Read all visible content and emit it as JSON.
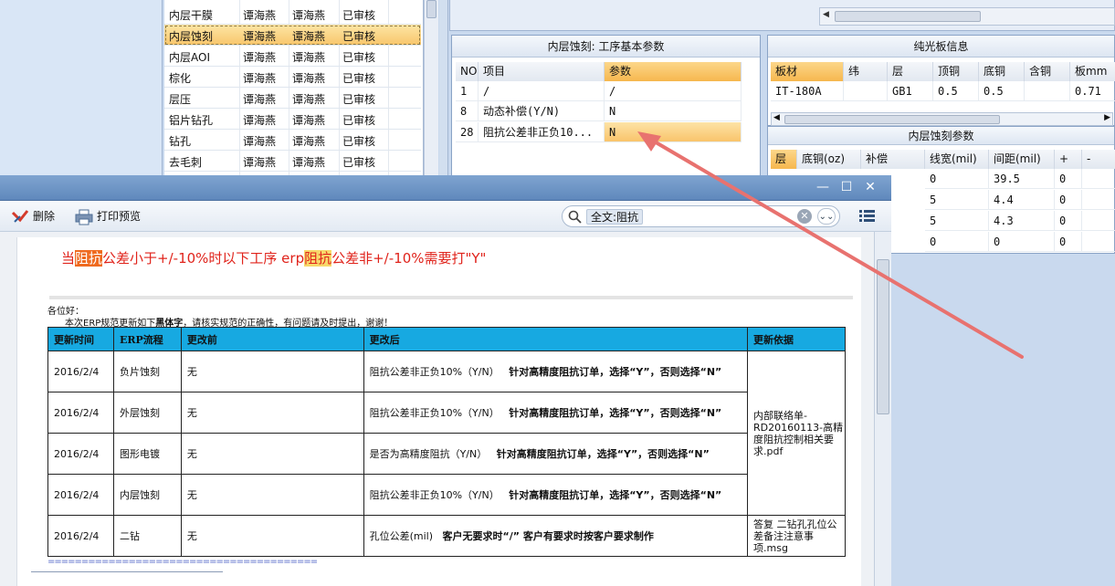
{
  "process_list": {
    "rows": [
      {
        "name": "内层干膜",
        "a": "谭海燕",
        "b": "谭海燕",
        "status": "已审核"
      },
      {
        "name": "内层蚀刻",
        "a": "谭海燕",
        "b": "谭海燕",
        "status": "已审核"
      },
      {
        "name": "内层AOI",
        "a": "谭海燕",
        "b": "谭海燕",
        "status": "已审核"
      },
      {
        "name": "棕化",
        "a": "谭海燕",
        "b": "谭海燕",
        "status": "已审核"
      },
      {
        "name": "层压",
        "a": "谭海燕",
        "b": "谭海燕",
        "status": "已审核"
      },
      {
        "name": "铝片钻孔",
        "a": "谭海燕",
        "b": "谭海燕",
        "status": "已审核"
      },
      {
        "name": "钻孔",
        "a": "谭海燕",
        "b": "谭海燕",
        "status": "已审核"
      },
      {
        "name": "去毛刺",
        "a": "谭海燕",
        "b": "谭海燕",
        "status": "已审核"
      }
    ]
  },
  "params_panel": {
    "title": "内层蚀刻: 工序基本参数",
    "headers": {
      "no": "NO",
      "item": "项目",
      "param": "参数"
    },
    "rows": [
      {
        "no": "1",
        "item": "/",
        "param": "/"
      },
      {
        "no": "8",
        "item": "动态补偿(Y/N)",
        "param": "N"
      },
      {
        "no": "28",
        "item": "阻抗公差非正负10...",
        "param": "N"
      }
    ]
  },
  "light_board": {
    "title": "纯光板信息",
    "headers": [
      "板材",
      "纬",
      "层",
      "顶铜",
      "底铜",
      "含铜",
      "板mm"
    ],
    "row": [
      "IT-180A",
      "",
      "GB1",
      "0.5",
      "0.5",
      "",
      "0.71"
    ]
  },
  "etch_params": {
    "title": "内层蚀刻参数",
    "headers": [
      "层",
      "底铜(oz)",
      "补偿",
      "线宽(mil)",
      "间距(mil)",
      "+",
      "-"
    ],
    "rows": [
      [
        "",
        "",
        "",
        "0",
        "39.5",
        "0",
        ""
      ],
      [
        "",
        "",
        "",
        "5",
        "4.4",
        "0",
        ""
      ],
      [
        "",
        "",
        "",
        "5",
        "4.3",
        "0",
        ""
      ],
      [
        "",
        "",
        "",
        "0",
        "0",
        "0",
        ""
      ]
    ]
  },
  "window": {
    "toolbar": {
      "delete_label": "删除",
      "print_preview_label": "打印预览"
    },
    "search": {
      "tag": "全文:阻抗"
    }
  },
  "document": {
    "headline": {
      "p1": "当",
      "p2": "阻抗",
      "p3": "公差小于+/-10%时以下工序 erp",
      "p4": "阻抗",
      "p5": "公差非+/-10%需要打\"Y\""
    },
    "greeting": "各位好：",
    "intro": {
      "before": "本次ERP规范更新如下",
      "bold": "黑体字",
      "after": "，请核实规范的正确性，有问题请及时提出，谢谢！"
    },
    "table": {
      "headers": [
        "更新时间",
        "ERP流程",
        "更改前",
        "更改后",
        "更新依据"
      ],
      "rows": [
        {
          "date": "2016/2/4",
          "flow": "负片蚀刻",
          "before": "无",
          "after_plain": "阻抗公差非正负10%（Y/N）",
          "after_bold": "针对高精度阻抗订单，选择“Y”，否则选择“N”"
        },
        {
          "date": "2016/2/4",
          "flow": "外层蚀刻",
          "before": "无",
          "after_plain": "阻抗公差非正负10%（Y/N）",
          "after_bold": "针对高精度阻抗订单，选择“Y”，否则选择“N”"
        },
        {
          "date": "2016/2/4",
          "flow": "图形电镀",
          "before": "无",
          "after_plain": "是否为高精度阻抗（Y/N）",
          "after_bold": "针对高精度阻抗订单，选择“Y”，否则选择“N”"
        },
        {
          "date": "2016/2/4",
          "flow": "内层蚀刻",
          "before": "无",
          "after_plain": "阻抗公差非正负10%（Y/N）",
          "after_bold": "针对高精度阻抗订单，选择“Y”，否则选择“N”"
        },
        {
          "date": "2016/2/4",
          "flow": "二钻",
          "before": "无",
          "after_plain": "孔位公差(mil)",
          "after_bold": "客户无要求时“/” 客户有要求时按客户要求制作"
        }
      ],
      "basis_1": "内部联络单-RD20160113-高精度阻抗控制相关要求.pdf",
      "basis_2": "答复 二钻孔孔位公差备注注意事项.msg"
    },
    "footer_line": "========================================"
  },
  "colors": {
    "accent_blue": "#17a9e1",
    "highlight_orange": "#f6b74e",
    "arrow": "#e8726f",
    "headline_red": "#e0231b"
  }
}
